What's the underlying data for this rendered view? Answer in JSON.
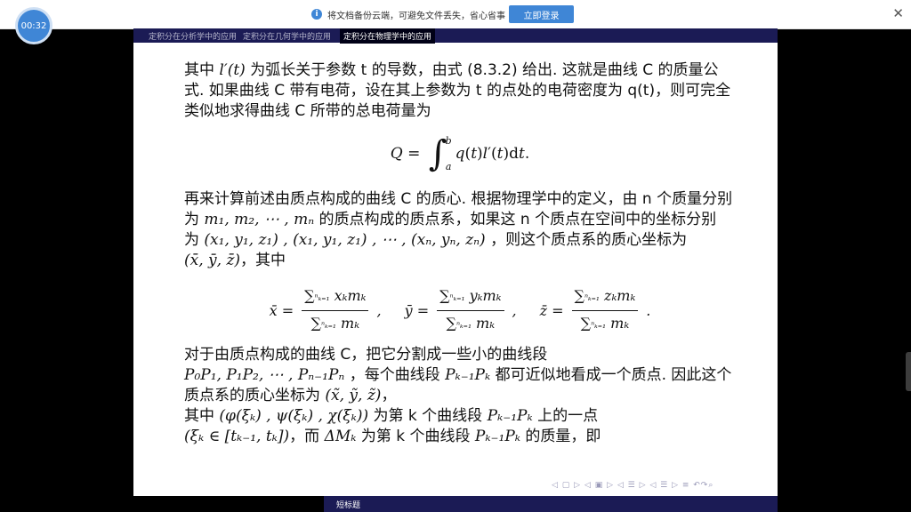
{
  "timer": "00:32",
  "notice": {
    "text": "将文档备份云端，可避免文件丢失，省心省事",
    "button": "立即登录"
  },
  "nav": {
    "items": [
      "定积分在分析学中的应用",
      "定积分在几何学中的应用",
      "定积分在物理学中的应用"
    ]
  },
  "content": {
    "p1a": "其中",
    "p1b": "为弧长关于参数 t 的导数，由式 (8.3.2) 给出. 这就是曲线 C 的质量公式. 如果曲线 C 带有电荷，设在其上参数为 t 的点处的电荷密度为 q(t)，则可完全类似地求得曲线 C 所带的总电荷量为",
    "p2a": "再来计算前述由质点构成的曲线 C 的质心. 根据物理学中的定义，由 n 个质量分别为",
    "p2b": "的质点构成的质点系，如果这 n 个质点在空间中的坐标分别",
    "p2c": "为",
    "p2d": "，则这个质点系的质心坐标为",
    "p2e": "，其中",
    "p3a": "对于由质点构成的曲线 C，把它分割成一些小的曲线段",
    "p3b": "，每个曲线段",
    "p3c": "都可近似地看成一个质点. 因此这个质点系的质心坐标为",
    "p3d": "，",
    "p4a": "其中",
    "p4b": "为第 k 个曲线段",
    "p4c": "上的一点",
    "p5a": "，而",
    "p5b": "为第 k 个曲线段",
    "p5c": "的质量，即"
  },
  "footer": {
    "short_title": "短标题"
  }
}
